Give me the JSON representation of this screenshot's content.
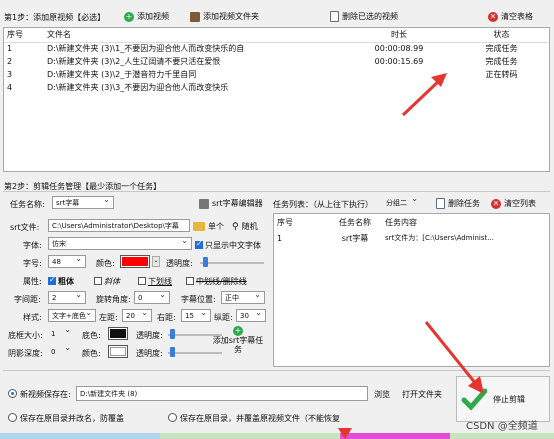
{
  "step1": {
    "label": "第1步：添加原视频【必选】",
    "add_video": "添加视频",
    "add_folder": "添加视频文件夹",
    "delete_selected": "删除已选的视频",
    "clear_table": "清空表格",
    "columns": [
      "序号",
      "文件名",
      "时长",
      "状态"
    ],
    "rows": [
      {
        "no": "1",
        "file": "D:\\新建文件夹 (3)\\1_不要因为迎合他人而改变快乐的自",
        "duration": "00:00:08.99",
        "status": "完成任务"
      },
      {
        "no": "2",
        "file": "D:\\新建文件夹 (3)\\2_人生辽阔请不要只活在爱恨",
        "duration": "00:00:15.69",
        "status": "完成任务"
      },
      {
        "no": "3",
        "file": "D:\\新建文件夹 (3)\\2_于潜音符力千里自同",
        "duration": "",
        "status": "正在转码"
      },
      {
        "no": "4",
        "file": "D:\\新建文件夹 (3)\\3_不要因为迎合他人而改变快乐",
        "duration": "",
        "status": ""
      }
    ]
  },
  "step2": {
    "label": "第2步：剪辑任务管理【最少添加一个任务】",
    "task_name_label": "任务名称:",
    "task_name_value": "srt字幕",
    "srt_editor": "srt字幕编辑器",
    "task_list_label": "任务列表：（从上往下执行）",
    "group_value": "分组二",
    "delete_task": "删除任务",
    "clear_list": "清空列表",
    "srt_file_label": "srt文件:",
    "srt_file_value": "C:\\Users\\Administrator\\Desktop\\字幕",
    "single": "单个",
    "random": "随机",
    "font_label": "字体:",
    "font_value": "仿宋",
    "only_chinese": "只显示中文字体",
    "size_label": "字号:",
    "size_value": "48",
    "color_label": "颜色:",
    "color_value": "#ff0000",
    "opacity_label": "透明度:",
    "attr_label": "属性:",
    "bold": "粗体",
    "italic": "斜体",
    "underline": "下划线",
    "strikethrough": "中划线/删除线",
    "spacing_label": "字间距:",
    "spacing_value": "2",
    "rotate_label": "旋转角度:",
    "rotate_value": "0",
    "position_label": "字幕位置:",
    "position_value": "正中",
    "style_label": "样式:",
    "style_value": "文字+底色",
    "left_margin_label": "左距:",
    "left_margin_value": "20",
    "right_margin_label": "右距:",
    "right_margin_value": "15",
    "vertical_margin_label": "纵距:",
    "vertical_margin_value": "30",
    "bg_size_label": "底框大小:",
    "bg_size_value": "1",
    "bg_color_label": "底色:",
    "bg_color_value": "#111111",
    "bg_opacity_label": "透明度:",
    "shadow_label": "阴影深度:",
    "shadow_value": "0",
    "shadow_color_label": "颜色:",
    "shadow_color_value": "#ffffff",
    "shadow_opacity_label": "透明度:",
    "add_task": "添加srt字幕任务",
    "task_columns": [
      "序号",
      "任务名称",
      "任务内容"
    ],
    "tasks": [
      {
        "no": "1",
        "name": "srt字幕",
        "content": "srt文件为：[C:\\Users\\Administ..."
      }
    ]
  },
  "output": {
    "save_new_label": "新视频保存在:",
    "save_path": "D:\\新建文件夹 (8)",
    "browse": "浏览",
    "open_folder": "打开文件夹",
    "stop": "停止剪辑",
    "opt_rename": "保存在原目录并改名，防覆盖",
    "opt_overwrite": "保存在原目录，并覆盖原视频文件（不能恢复",
    "watermark": "CSDN @全频道"
  }
}
